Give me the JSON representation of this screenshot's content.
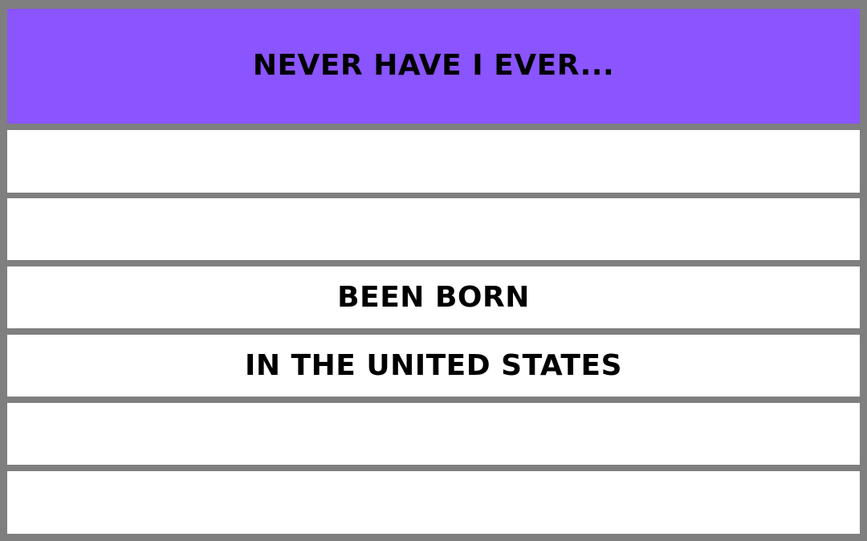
{
  "card": {
    "title": "NEVER HAVE I EVER...",
    "lines": [
      "",
      "",
      "BEEN BORN",
      "IN THE UNITED STATES",
      "",
      ""
    ]
  },
  "colors": {
    "frame": "#7f7f7f",
    "header": "#8a54ff",
    "row": "#ffffff",
    "text": "#000000"
  }
}
